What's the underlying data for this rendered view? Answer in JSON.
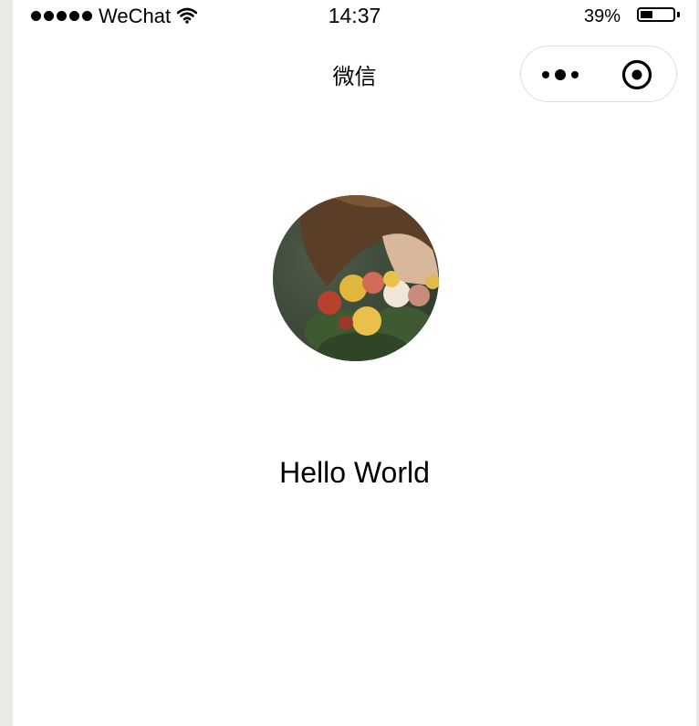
{
  "status_bar": {
    "carrier": "WeChat",
    "time": "14:37",
    "battery_percent": "39%",
    "battery_level": 0.39,
    "signal_icon": "signal-dots-icon",
    "wifi_icon": "wifi-icon",
    "battery_icon": "battery-icon"
  },
  "nav": {
    "title": "微信",
    "more_icon": "more-dots-icon",
    "close_icon": "target-close-icon"
  },
  "main": {
    "avatar_alt": "user-avatar",
    "greeting": "Hello World"
  },
  "colors": {
    "background": "#ffffff",
    "text": "#000000",
    "capsule_border": "#dedede"
  }
}
